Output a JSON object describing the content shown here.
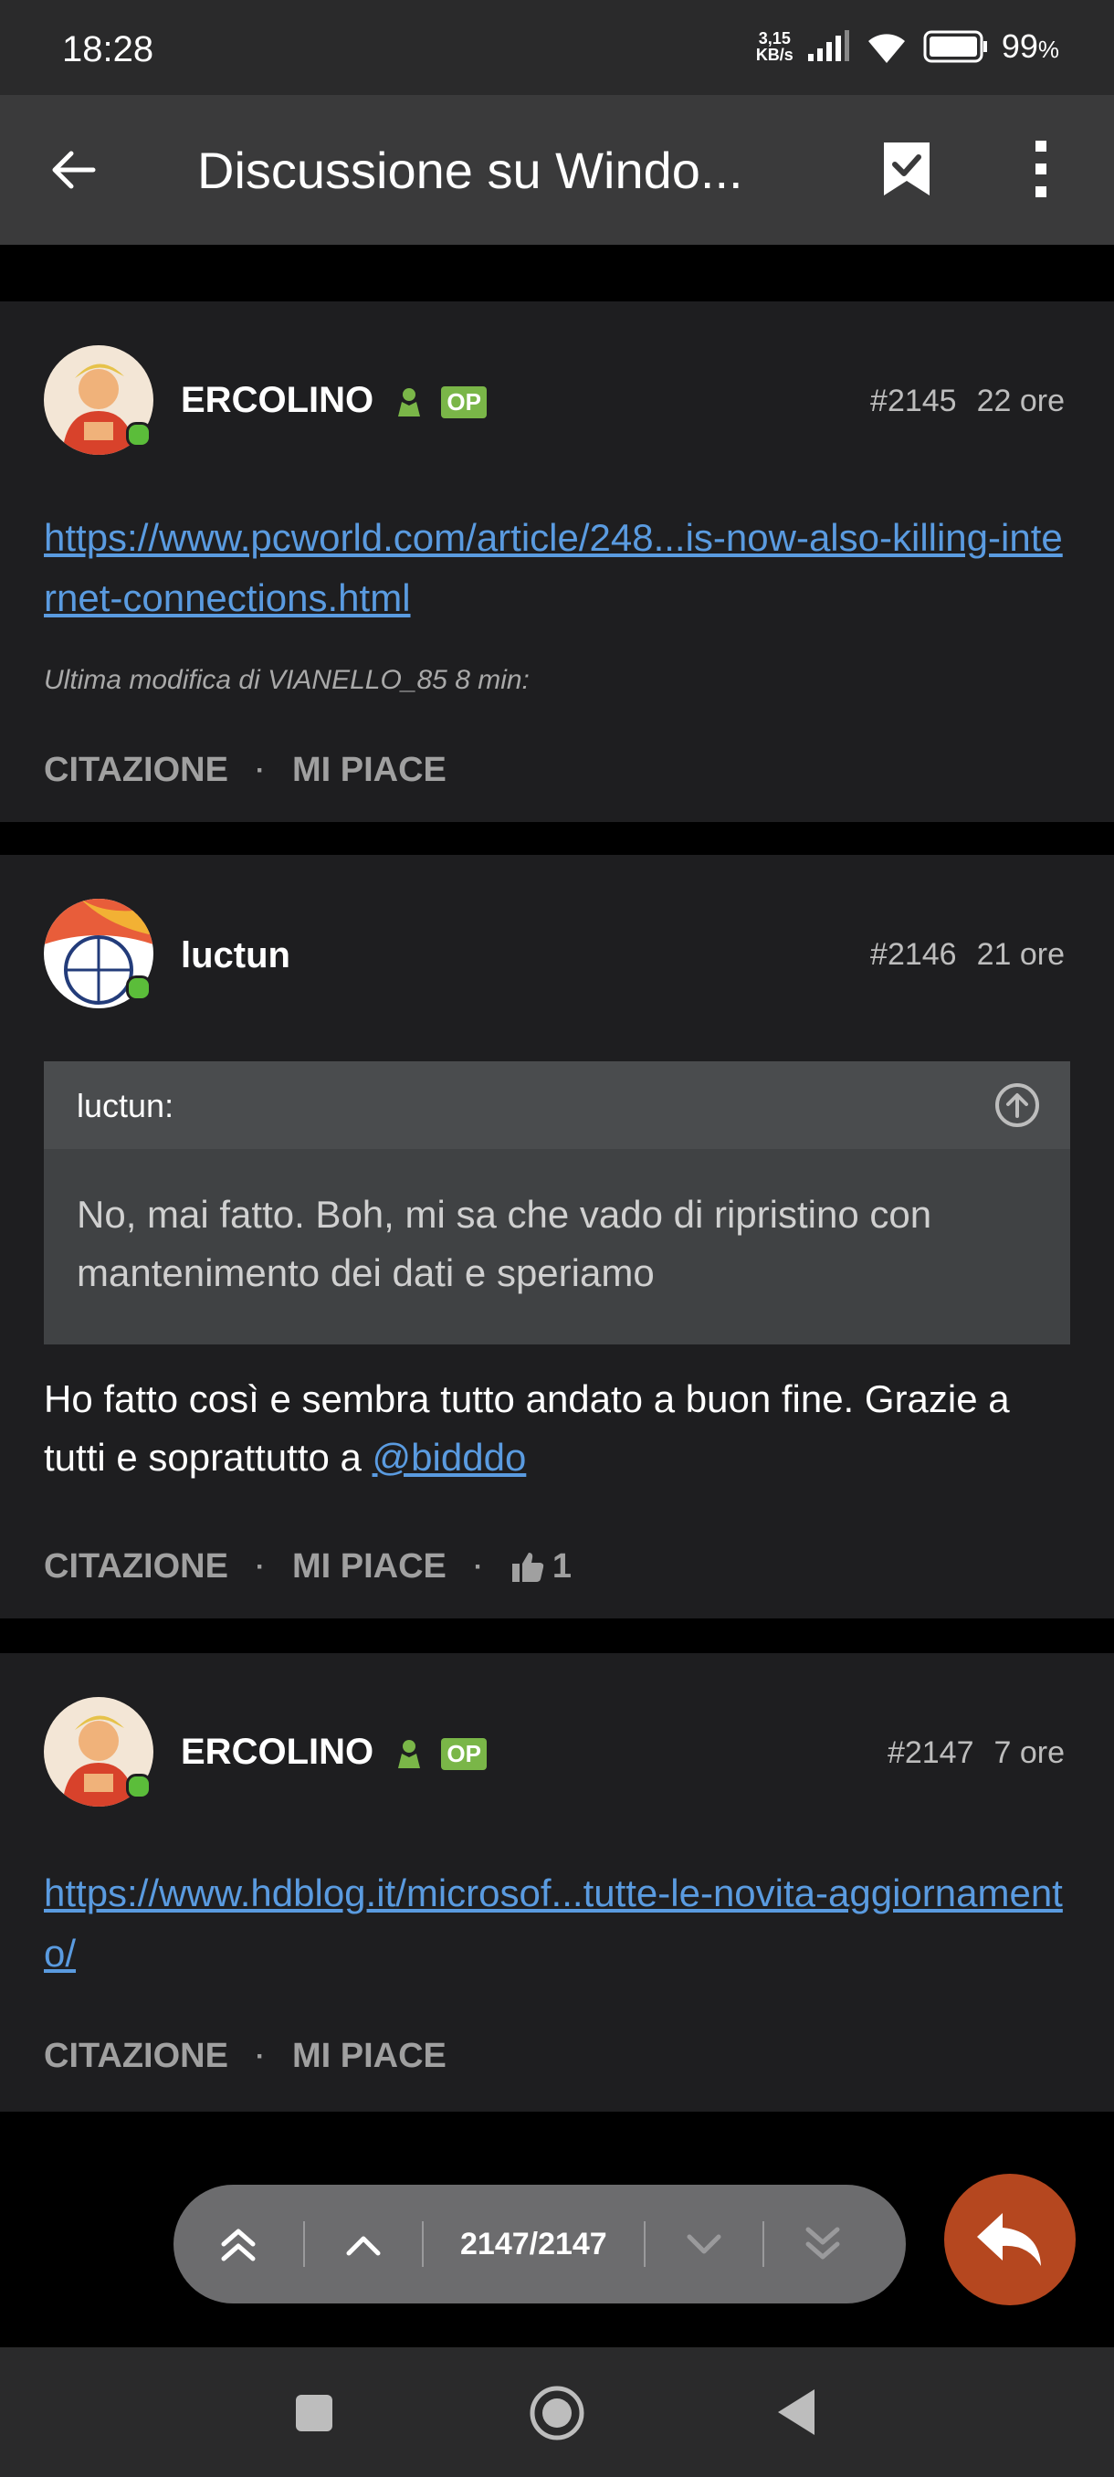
{
  "status_bar": {
    "time": "18:28",
    "net_speed_value": "3,15",
    "net_speed_unit": "KB/s",
    "battery": "99"
  },
  "app_bar": {
    "title": "Discussione su Windo..."
  },
  "posts": [
    {
      "username": "ERCOLINO",
      "badge": "OP",
      "number": "#2145",
      "time": "22 ore",
      "link": "https://www.pcworld.com/article/248...is-now-also-killing-internet-connections.html",
      "edit_note": "Ultima modifica di VIANELLO_85 8 min:",
      "action_quote": "CITAZIONE",
      "action_like": "MI PIACE"
    },
    {
      "username": "luctun",
      "number": "#2146",
      "time": "21 ore",
      "quote_author": "luctun:",
      "quote_text": "No, mai fatto. Boh, mi sa che vado di ripristino con mantenimento dei dati e speriamo",
      "body_text": "Ho fatto così e sembra tutto andato a buon fine. Grazie a tutti e soprattutto a ",
      "mention": "@bidddo",
      "action_quote": "CITAZIONE",
      "action_like": "MI PIACE",
      "like_count": "1"
    },
    {
      "username": "ERCOLINO",
      "badge": "OP",
      "number": "#2147",
      "time": "7 ore",
      "link": "https://www.hdblog.it/microsof...tutte-le-novita-aggiornamento/",
      "action_quote": "CITAZIONE",
      "action_like": "MI PIACE"
    }
  ],
  "navigation": {
    "counter": "2147/2147"
  },
  "colors": {
    "accent_link": "#5a9be0",
    "fab": "#b5471f",
    "op_badge": "#7ab648",
    "online": "#5bbd3a"
  }
}
